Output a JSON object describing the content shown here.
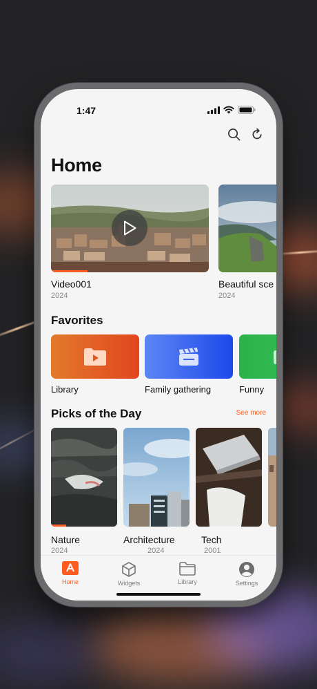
{
  "status": {
    "time": "1:47"
  },
  "page": {
    "title": "Home"
  },
  "videos": [
    {
      "title": "Video001",
      "year": "2024",
      "progress": 0.23
    },
    {
      "title": "Beautiful sce",
      "year": "2024"
    }
  ],
  "favorites": {
    "title": "Favorites",
    "items": [
      {
        "label": "Library",
        "color": "#e8552a",
        "icon": "play-folder-icon"
      },
      {
        "label": "Family gathering",
        "color": "#2f62f0",
        "icon": "clapperboard-icon"
      },
      {
        "label": "Funny",
        "color": "#2fb84a",
        "icon": "folder-icon"
      }
    ]
  },
  "picks": {
    "title": "Picks of the Day",
    "see_more": "See more",
    "items": [
      {
        "title": "Nature",
        "year": "2024"
      },
      {
        "title": "Architecture",
        "year": "2024"
      },
      {
        "title": "Tech",
        "year": "2001"
      },
      {
        "title": "",
        "year": ""
      }
    ]
  },
  "tabs": [
    {
      "label": "Home",
      "icon": "home-app-icon",
      "active": true
    },
    {
      "label": "Widgets",
      "icon": "cube-icon",
      "active": false
    },
    {
      "label": "Library",
      "icon": "folder-icon",
      "active": false
    },
    {
      "label": "Settings",
      "icon": "user-circle-icon",
      "active": false
    }
  ],
  "colors": {
    "accent": "#ff5a1f",
    "background": "#f5f5f5"
  }
}
